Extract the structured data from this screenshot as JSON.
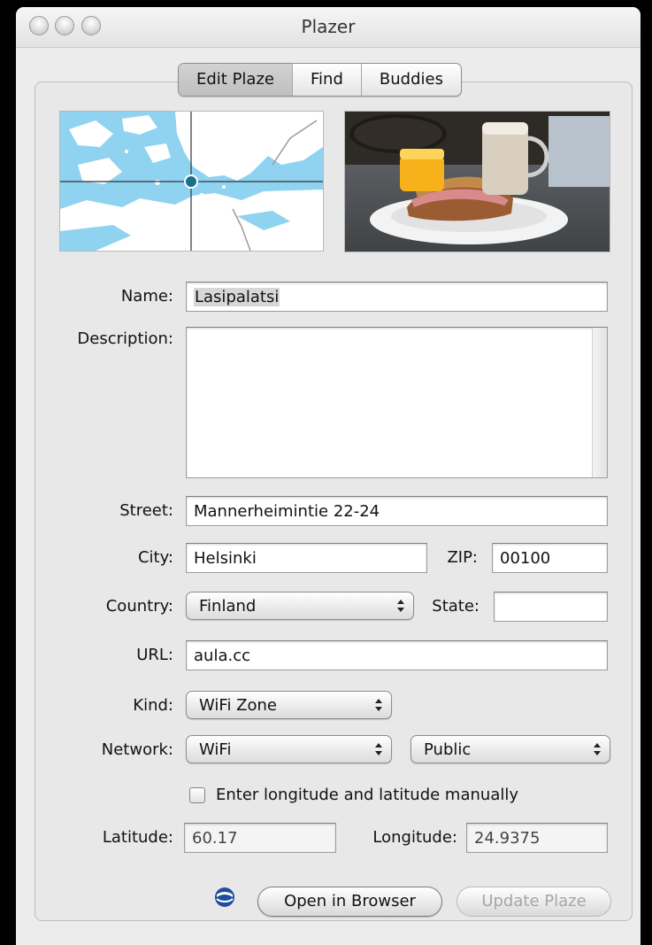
{
  "window": {
    "title": "Plazer"
  },
  "tabs": [
    {
      "label": "Edit Plaze",
      "active": true
    },
    {
      "label": "Find",
      "active": false
    },
    {
      "label": "Buddies",
      "active": false
    }
  ],
  "form": {
    "name_label": "Name:",
    "name_value": "Lasipalatsi",
    "description_label": "Description:",
    "description_value": "",
    "street_label": "Street:",
    "street_value": "Mannerheimintie 22-24",
    "city_label": "City:",
    "city_value": "Helsinki",
    "zip_label": "ZIP:",
    "zip_value": "00100",
    "country_label": "Country:",
    "country_value": "Finland",
    "state_label": "State:",
    "state_value": "",
    "url_label": "URL:",
    "url_value": "aula.cc",
    "kind_label": "Kind:",
    "kind_value": "WiFi Zone",
    "network_label": "Network:",
    "network_value": "WiFi",
    "access_value": "Public",
    "manual_coords_label": "Enter longitude and latitude manually",
    "manual_coords_checked": false,
    "latitude_label": "Latitude:",
    "latitude_value": "60.17",
    "longitude_label": "Longitude:",
    "longitude_value": "24.9375"
  },
  "buttons": {
    "open_browser": "Open in Browser",
    "update_plaze": "Update Plaze"
  },
  "icons": {
    "globe": "globe-icon",
    "map": "map-view",
    "photo": "photo-view"
  },
  "colors": {
    "map_water": "#8fd3f0",
    "map_land": "#ffffff",
    "map_marker": "#1a6f8c"
  }
}
